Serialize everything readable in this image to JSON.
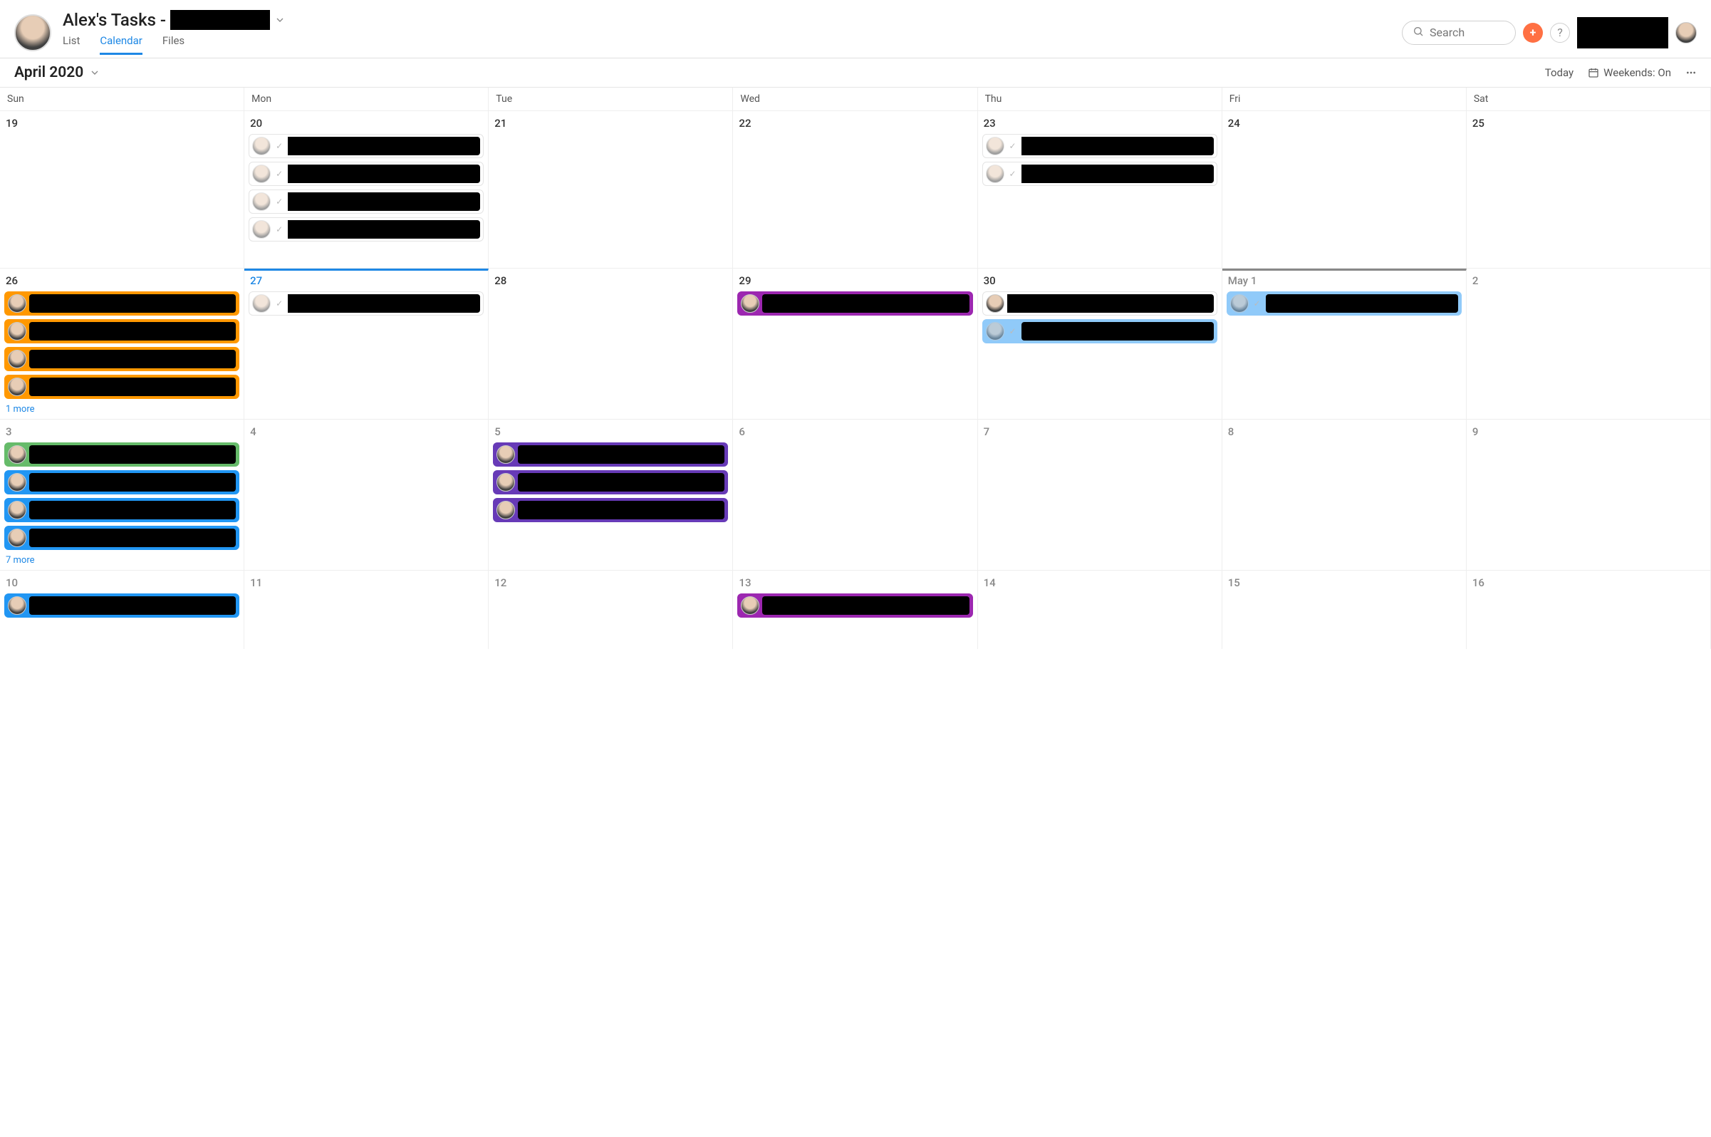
{
  "header": {
    "title_prefix": "Alex's Tasks -",
    "title_redacted": true,
    "tabs": {
      "list": "List",
      "calendar": "Calendar",
      "files": "Files",
      "active": "calendar"
    },
    "search_placeholder": "Search",
    "add_label": "+",
    "help_label": "?"
  },
  "subheader": {
    "month_label": "April 2020",
    "today_label": "Today",
    "weekends_label": "Weekends: On",
    "more_label": "…"
  },
  "weekdays": [
    "Sun",
    "Mon",
    "Tue",
    "Wed",
    "Thu",
    "Fri",
    "Sat"
  ],
  "task_colors": {
    "white": "#ffffff",
    "orange": "#ff9800",
    "purple": "#9c27b0",
    "lightblue": "#90caf9",
    "green": "#66bb6a",
    "blue": "#2196f3",
    "darkpurple": "#673ab7"
  },
  "weeks": [
    {
      "days": [
        {
          "num": "19",
          "tasks": []
        },
        {
          "num": "20",
          "tasks": [
            {
              "color": "white",
              "dim": true,
              "check": true,
              "redacted": true
            },
            {
              "color": "white",
              "dim": true,
              "check": true,
              "redacted": true
            },
            {
              "color": "white",
              "dim": true,
              "check": true,
              "redacted": true
            },
            {
              "color": "white",
              "dim": true,
              "check": true,
              "redacted": true
            }
          ]
        },
        {
          "num": "21",
          "tasks": []
        },
        {
          "num": "22",
          "tasks": []
        },
        {
          "num": "23",
          "tasks": [
            {
              "color": "white",
              "dim": true,
              "check": true,
              "redacted": true
            },
            {
              "color": "white",
              "dim": true,
              "check": true,
              "redacted": true
            }
          ]
        },
        {
          "num": "24",
          "tasks": []
        },
        {
          "num": "25",
          "tasks": []
        }
      ]
    },
    {
      "days": [
        {
          "num": "26",
          "tasks": [
            {
              "color": "orange",
              "redacted": true
            },
            {
              "color": "orange",
              "redacted": true
            },
            {
              "color": "orange",
              "redacted": true
            },
            {
              "color": "orange",
              "redacted": true
            }
          ],
          "more": "1 more"
        },
        {
          "num": "27",
          "today": true,
          "today_line": true,
          "tasks": [
            {
              "color": "white",
              "dim": true,
              "check": true,
              "redacted": true
            }
          ]
        },
        {
          "num": "28",
          "tasks": []
        },
        {
          "num": "29",
          "tasks": [
            {
              "color": "purple",
              "redacted": true
            }
          ]
        },
        {
          "num": "30",
          "tasks": [
            {
              "color": "white",
              "redacted": true
            },
            {
              "color": "lightblue",
              "dim": true,
              "check": true,
              "redacted": true
            }
          ]
        },
        {
          "num": "May 1",
          "other_month": true,
          "gray_line": true,
          "tasks": [
            {
              "color": "lightblue",
              "dim": true,
              "check": true,
              "redacted": true
            }
          ]
        },
        {
          "num": "2",
          "other_month": true,
          "tasks": []
        }
      ]
    },
    {
      "days": [
        {
          "num": "3",
          "other_month": true,
          "tasks": [
            {
              "color": "green",
              "redacted": true
            },
            {
              "color": "blue",
              "redacted": true
            },
            {
              "color": "blue",
              "redacted": true
            },
            {
              "color": "blue",
              "redacted": true
            }
          ],
          "more": "7 more"
        },
        {
          "num": "4",
          "other_month": true,
          "tasks": []
        },
        {
          "num": "5",
          "other_month": true,
          "tasks": [
            {
              "color": "darkpurple",
              "redacted": true
            },
            {
              "color": "darkpurple",
              "redacted": true
            },
            {
              "color": "darkpurple",
              "redacted": true
            }
          ]
        },
        {
          "num": "6",
          "other_month": true,
          "tasks": []
        },
        {
          "num": "7",
          "other_month": true,
          "tasks": []
        },
        {
          "num": "8",
          "other_month": true,
          "tasks": []
        },
        {
          "num": "9",
          "other_month": true,
          "tasks": []
        }
      ]
    },
    {
      "days": [
        {
          "num": "10",
          "other_month": true,
          "tasks": [
            {
              "color": "blue",
              "redacted": true
            }
          ]
        },
        {
          "num": "11",
          "other_month": true,
          "tasks": []
        },
        {
          "num": "12",
          "other_month": true,
          "tasks": []
        },
        {
          "num": "13",
          "other_month": true,
          "tasks": [
            {
              "color": "purple",
              "redacted": true
            }
          ]
        },
        {
          "num": "14",
          "other_month": true,
          "tasks": []
        },
        {
          "num": "15",
          "other_month": true,
          "tasks": []
        },
        {
          "num": "16",
          "other_month": true,
          "tasks": []
        }
      ]
    }
  ]
}
